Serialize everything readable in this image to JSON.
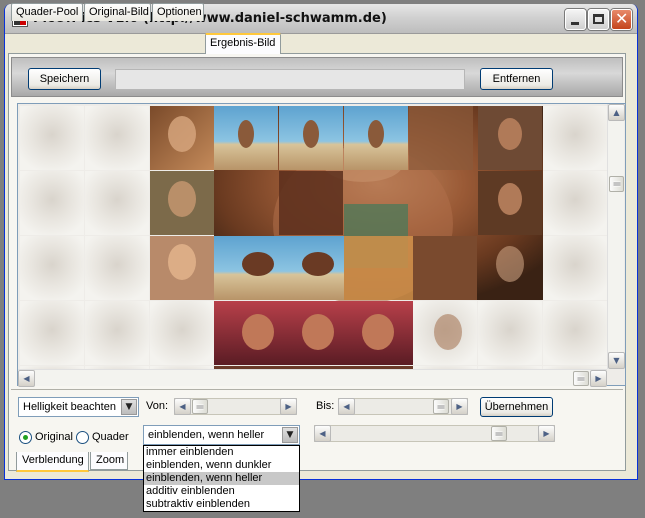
{
  "window": {
    "title": "PicOfPics V1.0 (http://www.daniel-schwamm.de)"
  },
  "tabs": [
    {
      "label": "Quader-Pool",
      "active": false
    },
    {
      "label": "Original-Bild",
      "active": false
    },
    {
      "label": "Optionen",
      "active": false
    },
    {
      "label": "Ergebnis-Bild",
      "active": true
    }
  ],
  "toolbar": {
    "save_label": "Speichern",
    "path_value": "",
    "remove_label": "Entfernen"
  },
  "controls": {
    "brightness_select": "Helligkeit beachten",
    "from_label": "Von:",
    "to_label": "Bis:",
    "apply_label": "Übernehmen",
    "radio_original": "Original",
    "radio_quader": "Quader",
    "radio_selected": "original",
    "blend_select": "einblenden, wenn heller"
  },
  "bottom_tabs": [
    {
      "label": "Verblendung",
      "active": true
    },
    {
      "label": "Zoom",
      "active": false
    }
  ],
  "blend_options": [
    "immer einblenden",
    "einblenden, wenn dunkler",
    "einblenden, wenn heller",
    "additiv einblenden",
    "subtraktiv einblenden"
  ],
  "blend_selected_index": 2,
  "icons": {
    "arrow_up": "▲",
    "arrow_down": "▼",
    "arrow_left": "◀",
    "arrow_right": "▶",
    "close": "✕"
  }
}
